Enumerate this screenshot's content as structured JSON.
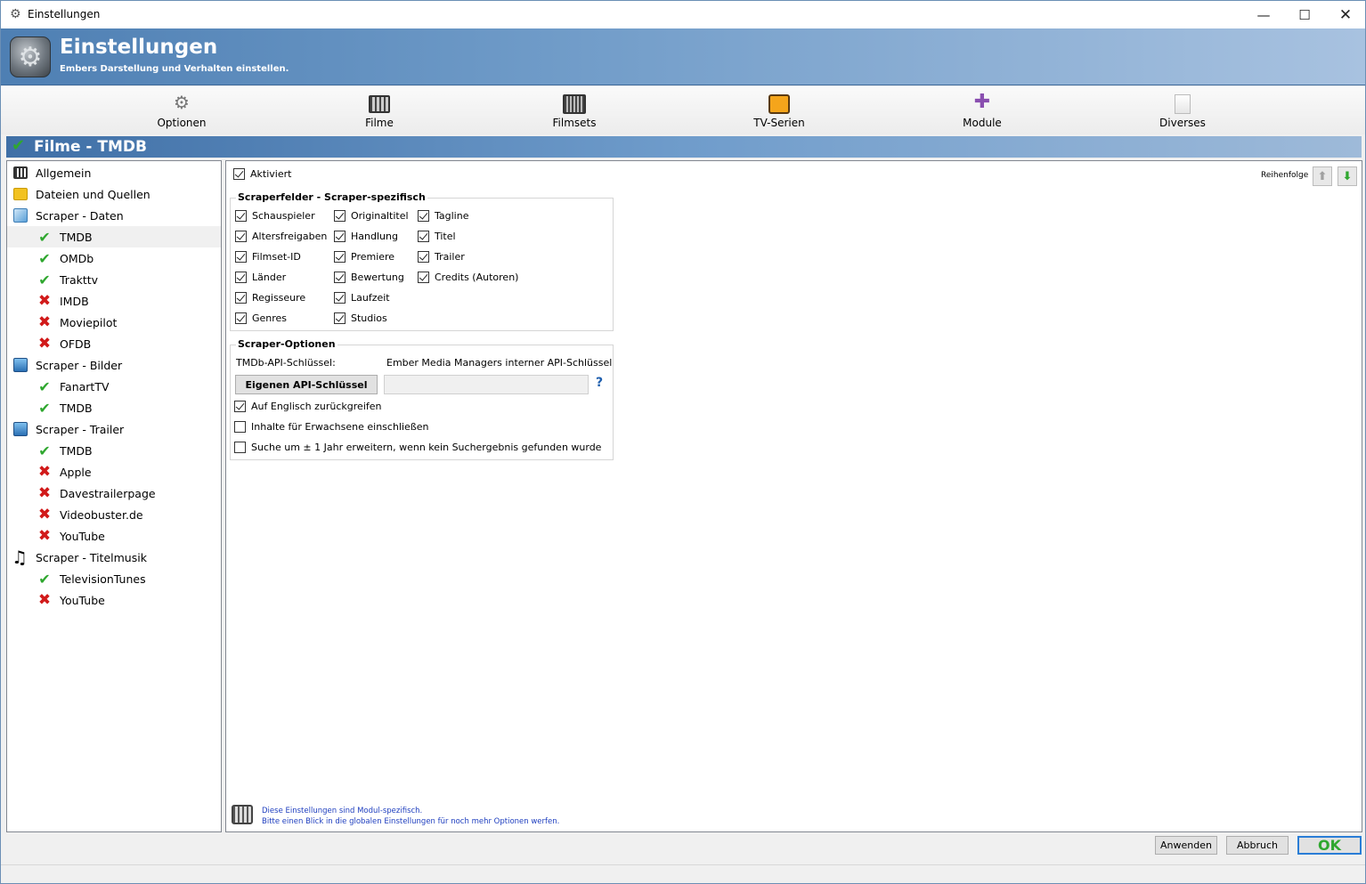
{
  "window": {
    "title": "Einstellungen"
  },
  "banner": {
    "title": "Einstellungen",
    "subtitle": "Embers Darstellung und Verhalten einstellen."
  },
  "toolbar": {
    "items": [
      {
        "label": "Optionen",
        "icon": "gear-icon"
      },
      {
        "label": "Filme",
        "icon": "film-icon"
      },
      {
        "label": "Filmsets",
        "icon": "filmset-icon"
      },
      {
        "label": "TV-Serien",
        "icon": "tv-icon"
      },
      {
        "label": "Module",
        "icon": "puzzle-icon"
      },
      {
        "label": "Diverses",
        "icon": "document-icon"
      }
    ]
  },
  "section": {
    "title": "Filme - TMDB"
  },
  "tree": {
    "items": [
      {
        "label": "Allgemein",
        "icon": "film-icon",
        "level": 0
      },
      {
        "label": "Dateien und Quellen",
        "icon": "folder-icon",
        "level": 0
      },
      {
        "label": "Scraper - Daten",
        "icon": "data-icon",
        "level": 0
      },
      {
        "label": "TMDB",
        "icon": "check-icon",
        "level": 1,
        "selected": true
      },
      {
        "label": "OMDb",
        "icon": "check-icon",
        "level": 1
      },
      {
        "label": "Trakttv",
        "icon": "check-icon",
        "level": 1
      },
      {
        "label": "IMDB",
        "icon": "cross-icon",
        "level": 1
      },
      {
        "label": "Moviepilot",
        "icon": "cross-icon",
        "level": 1
      },
      {
        "label": "OFDB",
        "icon": "cross-icon",
        "level": 1
      },
      {
        "label": "Scraper - Bilder",
        "icon": "picture-icon",
        "level": 0
      },
      {
        "label": "FanartTV",
        "icon": "check-icon",
        "level": 1
      },
      {
        "label": "TMDB",
        "icon": "check-icon",
        "level": 1
      },
      {
        "label": "Scraper - Trailer",
        "icon": "picture-icon",
        "level": 0
      },
      {
        "label": "TMDB",
        "icon": "check-icon",
        "level": 1
      },
      {
        "label": "Apple",
        "icon": "cross-icon",
        "level": 1
      },
      {
        "label": "Davestrailerpage",
        "icon": "cross-icon",
        "level": 1
      },
      {
        "label": "Videobuster.de",
        "icon": "cross-icon",
        "level": 1
      },
      {
        "label": "YouTube",
        "icon": "cross-icon",
        "level": 1
      },
      {
        "label": "Scraper - Titelmusik",
        "icon": "music-icon",
        "level": 0
      },
      {
        "label": "TelevisionTunes",
        "icon": "check-icon",
        "level": 1
      },
      {
        "label": "YouTube",
        "icon": "cross-icon",
        "level": 1
      }
    ]
  },
  "panel": {
    "enabled": {
      "label": "Aktiviert",
      "checked": true
    },
    "order_label": "Reihenfolge",
    "fields_group": {
      "title": "Scraperfelder - Scraper-spezifisch",
      "columns": [
        [
          {
            "label": "Schauspieler",
            "checked": true
          },
          {
            "label": "Altersfreigaben",
            "checked": true
          },
          {
            "label": "Filmset-ID",
            "checked": true
          },
          {
            "label": "Länder",
            "checked": true
          },
          {
            "label": "Regisseure",
            "checked": true
          },
          {
            "label": "Genres",
            "checked": true
          }
        ],
        [
          {
            "label": "Originaltitel",
            "checked": true
          },
          {
            "label": "Handlung",
            "checked": true
          },
          {
            "label": "Premiere",
            "checked": true
          },
          {
            "label": "Bewertung",
            "checked": true
          },
          {
            "label": "Laufzeit",
            "checked": true
          },
          {
            "label": "Studios",
            "checked": true
          }
        ],
        [
          {
            "label": "Tagline",
            "checked": true
          },
          {
            "label": "Titel",
            "checked": true
          },
          {
            "label": "Trailer",
            "checked": true
          },
          {
            "label": "Credits (Autoren)",
            "checked": true
          }
        ]
      ]
    },
    "options_group": {
      "title": "Scraper-Optionen",
      "api_key_label": "TMDb-API-Schlüssel:",
      "api_key_value": "Ember Media Managers interner API-Schlüssel",
      "own_key_button": "Eigenen API-Schlüssel",
      "api_input_value": "",
      "help": "?",
      "options": [
        {
          "label": "Auf Englisch zurückgreifen",
          "checked": true
        },
        {
          "label": "Inhalte für Erwachsene einschließen",
          "checked": false
        },
        {
          "label": "Suche um ± 1 Jahr erweitern, wenn kein Suchergebnis gefunden wurde",
          "checked": false
        }
      ]
    },
    "footer": {
      "line1": "Diese Einstellungen sind Modul-spezifisch.",
      "line2": "Bitte einen Blick in die globalen Einstellungen für noch mehr Optionen werfen."
    }
  },
  "buttons": {
    "apply": "Anwenden",
    "cancel": "Abbruch",
    "ok": "OK"
  }
}
